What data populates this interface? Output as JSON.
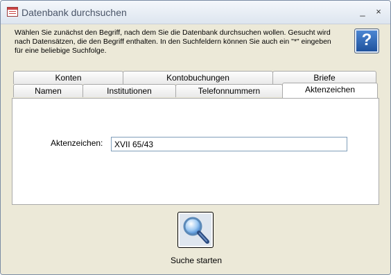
{
  "window": {
    "title": "Datenbank durchsuchen"
  },
  "titlebar": {
    "minimize": "_",
    "close": "×"
  },
  "intro": "Wählen Sie zunächst den Begriff, nach dem Sie die Datenbank durchsuchen wollen. Gesucht wird nach Datensätzen, die den Begriff enthalten. In den Suchfeldern können Sie auch ein \"*\" eingeben für eine beliebige Suchfolge.",
  "help": {
    "label": "?"
  },
  "tabs": {
    "back": [
      {
        "label": "Konten"
      },
      {
        "label": "Kontobuchungen"
      },
      {
        "label": "Briefe"
      }
    ],
    "front": [
      {
        "label": "Namen"
      },
      {
        "label": "Institutionen"
      },
      {
        "label": "Telefonnummern"
      },
      {
        "label": "Aktenzeichen"
      }
    ],
    "active": "Aktenzeichen"
  },
  "form": {
    "label": "Aktenzeichen:",
    "value": "XVII 65/43"
  },
  "search": {
    "label": "Suche starten"
  },
  "colors": {
    "accent": "#1c4f9a",
    "panel": "#ffffff",
    "background": "#ece9d8"
  }
}
